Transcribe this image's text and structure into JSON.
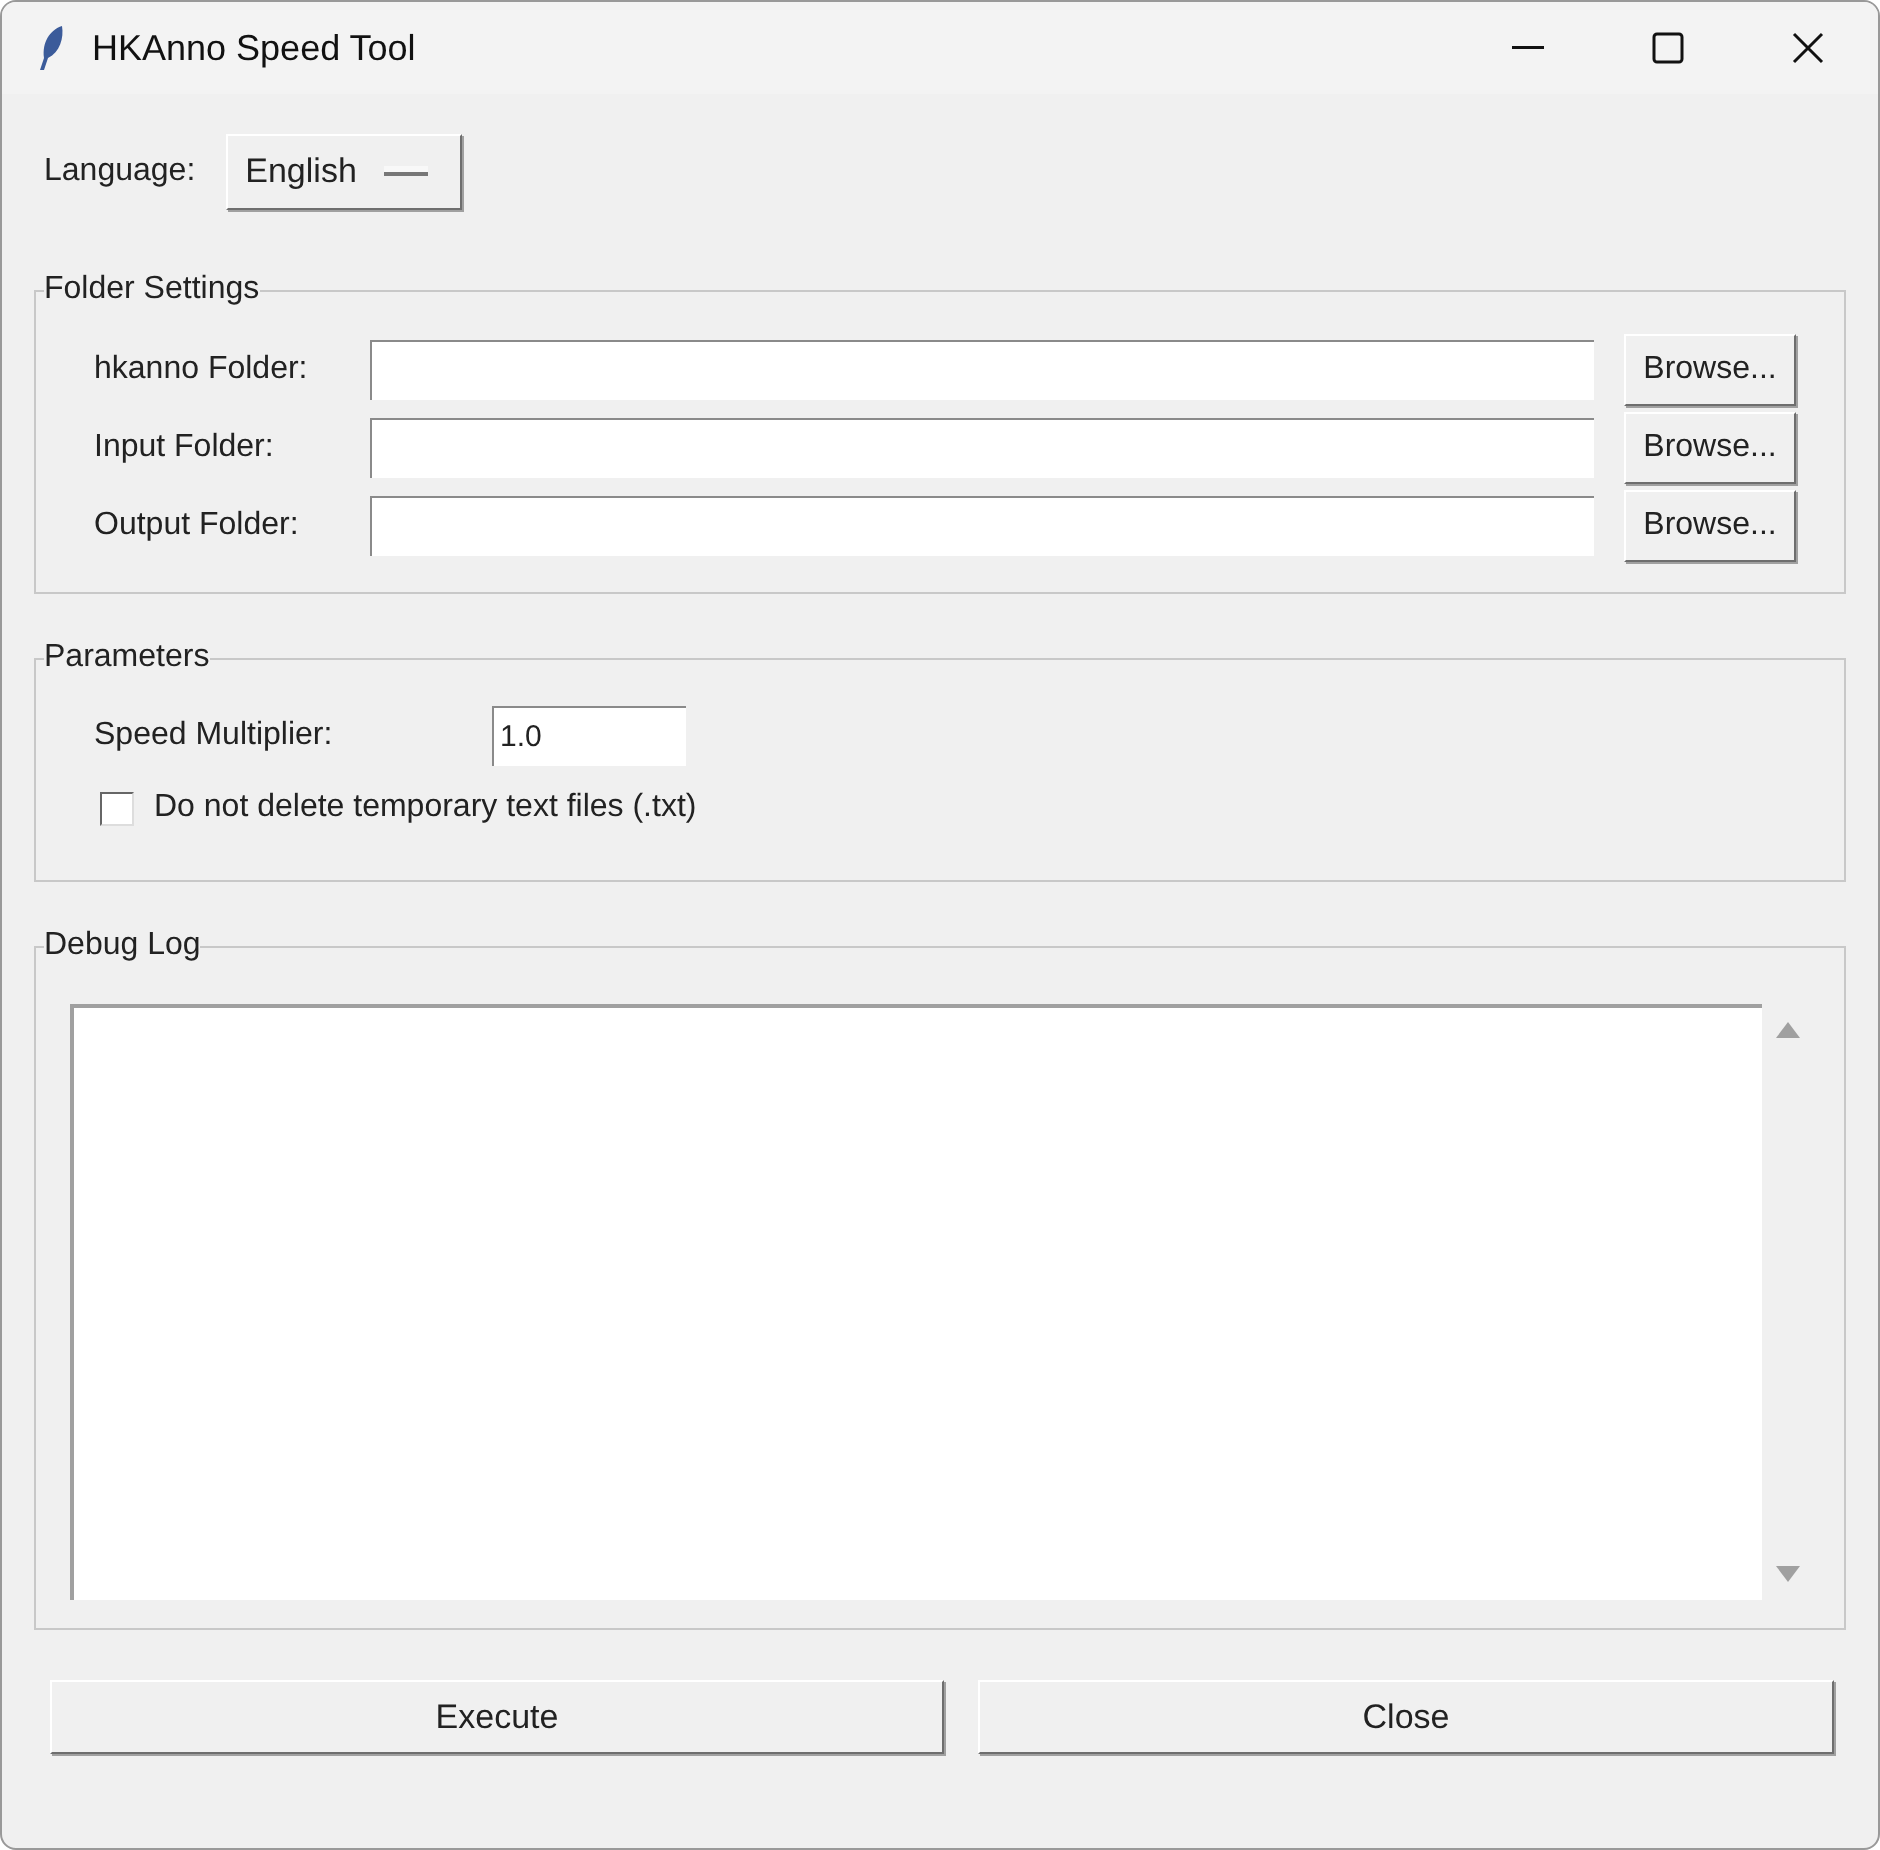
{
  "window": {
    "title": "HKAnno Speed Tool"
  },
  "language": {
    "label": "Language:",
    "value": "English"
  },
  "folder_settings": {
    "title": "Folder Settings",
    "rows": [
      {
        "label": "hkanno Folder:",
        "button": "Browse..."
      },
      {
        "label": "Input Folder:",
        "button": "Browse..."
      },
      {
        "label": "Output Folder:",
        "button": "Browse..."
      }
    ]
  },
  "parameters": {
    "title": "Parameters",
    "speed_label": "Speed Multiplier:",
    "speed_value": "1.0",
    "checkbox": {
      "label": "Do not delete temporary text files (.txt)",
      "checked": false
    }
  },
  "debug_log": {
    "title": "Debug Log"
  },
  "buttons": [
    "Execute",
    "Close"
  ]
}
